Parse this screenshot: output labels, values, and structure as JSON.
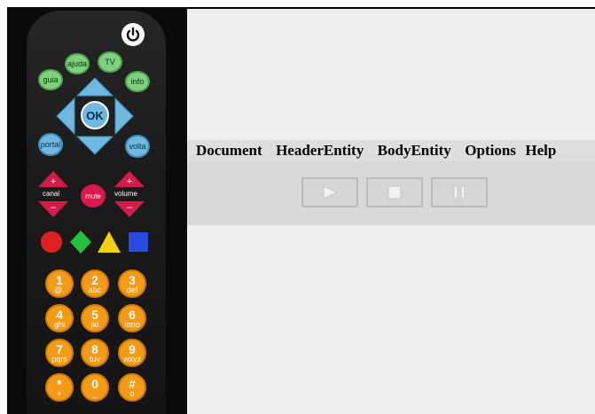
{
  "remote": {
    "power_icon": "power-icon",
    "top_buttons": {
      "ajuda": "ajuda",
      "tv": "TV",
      "guia": "guia",
      "info": "info"
    },
    "ok": "OK",
    "side_buttons": {
      "portal": "portal",
      "volta": "volta"
    },
    "canal": "canal",
    "mute": "mute",
    "volume": "volume",
    "colors": [
      "#e02020",
      "#22c23a",
      "#f0d010",
      "#2a4be0"
    ],
    "keypad": [
      {
        "digit": "1",
        "letters": "@."
      },
      {
        "digit": "2",
        "letters": "abc"
      },
      {
        "digit": "3",
        "letters": "def"
      },
      {
        "digit": "4",
        "letters": "ghi"
      },
      {
        "digit": "5",
        "letters": "jkl"
      },
      {
        "digit": "6",
        "letters": "mno"
      },
      {
        "digit": "7",
        "letters": "pqrs"
      },
      {
        "digit": "8",
        "letters": "tuv"
      },
      {
        "digit": "9",
        "letters": "wxyz"
      },
      {
        "digit": "*",
        "letters": "+"
      },
      {
        "digit": "0",
        "letters": "_"
      },
      {
        "digit": "#",
        "letters": "o"
      }
    ]
  },
  "menu": [
    "Document",
    "HeaderEntity",
    "BodyEntity",
    "Options",
    "Help"
  ],
  "toolbar": {
    "play_icon": "play-icon",
    "stop_icon": "stop-icon",
    "pause_icon": "pause-icon"
  }
}
